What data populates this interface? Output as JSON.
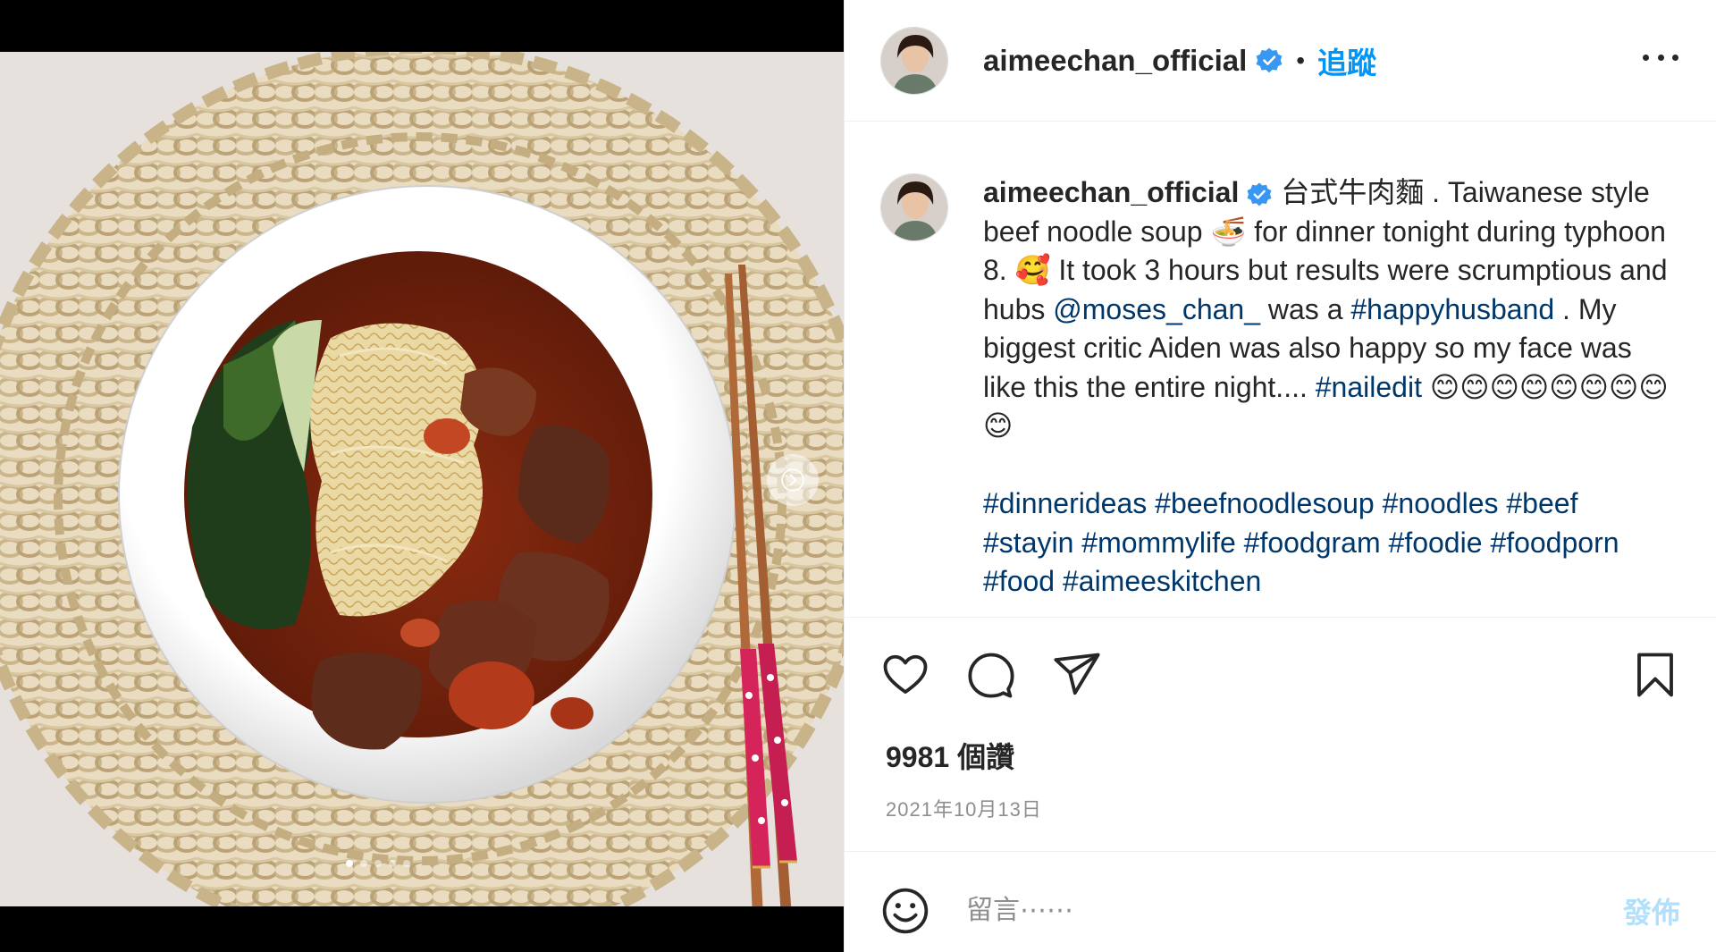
{
  "colors": {
    "accent": "#0095f6",
    "link": "#00376b",
    "verified": "#3897f0",
    "post_disabled": "#b2dffc",
    "muted": "#8e8e8e"
  },
  "header": {
    "username": "aimeechan_official",
    "separator": "•",
    "follow_label": "追蹤",
    "more_icon": "more-horizontal-icon"
  },
  "caption": {
    "username": "aimeechan_official",
    "segments": [
      {
        "text": " 台式牛肉麵 . Taiwanese style beef noodle soup 🍜 for dinner tonight during typhoon 8. 🥰 It took 3 hours but results were scrumptious and hubs "
      },
      {
        "text": "@moses_chan_",
        "link": true
      },
      {
        "text": " was a "
      },
      {
        "text": "#happyhusband",
        "link": true
      },
      {
        "text": " . My biggest critic Aiden was also happy so my face was like this the entire night.... "
      },
      {
        "text": "#nailedit",
        "link": true
      },
      {
        "text": " 😊😊😊😊😊😊😊😊😊"
      }
    ],
    "hashtags": [
      "#dinnerideas",
      "#beefnoodlesoup",
      "#noodles",
      "#beef",
      "#stayin",
      "#mommylife",
      "#foodgram",
      "#foodie",
      "#foodporn",
      "#food",
      "#aimeeskitchen"
    ]
  },
  "actions": {
    "like_icon": "heart-icon",
    "comment_icon": "comment-icon",
    "share_icon": "paper-plane-icon",
    "save_icon": "bookmark-icon"
  },
  "stats": {
    "likes": "9981 個讚",
    "date": "2021年10月13日"
  },
  "comment": {
    "emoji_icon": "emoji-icon",
    "placeholder": "留言⋯⋯",
    "post_label": "發佈"
  },
  "carousel": {
    "slide_count": 5,
    "current_index": 0,
    "next_icon": "chevron-right-icon"
  }
}
